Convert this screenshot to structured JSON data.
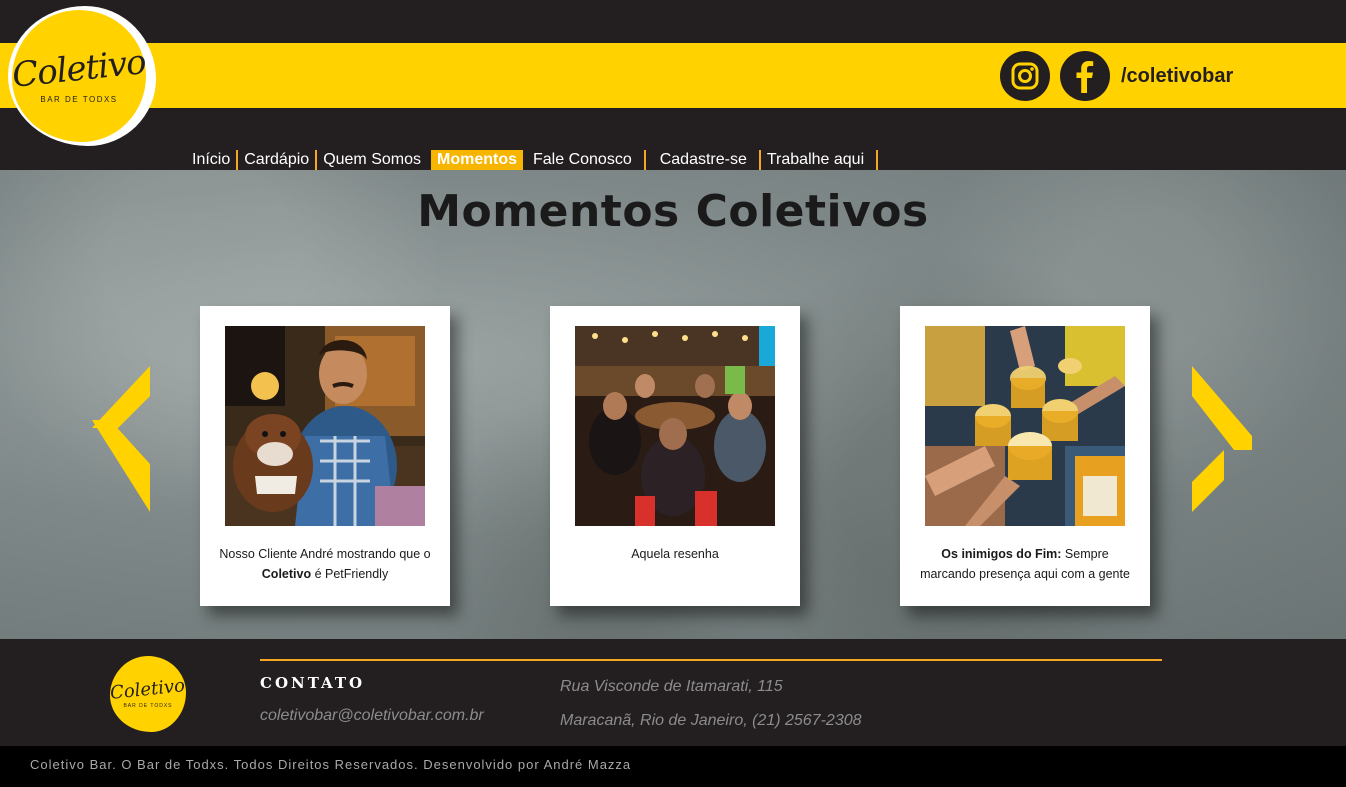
{
  "brand": {
    "logo_text": "Coletivo",
    "logo_sub": "BAR DE TODXS",
    "primary_color": "#ffd200",
    "dark_color": "#231f20",
    "accent_color": "#f5a623"
  },
  "social": {
    "icons": [
      "instagram-icon",
      "facebook-icon"
    ],
    "handle": "/coletivobar"
  },
  "nav": {
    "items": [
      {
        "label": "Início"
      },
      {
        "label": "Cardápio"
      },
      {
        "label": "Quem Somos"
      },
      {
        "label": "Momentos",
        "active": true
      },
      {
        "label": "Fale Conosco"
      },
      {
        "label": "Cadastre-se"
      },
      {
        "label": "Trabalhe aqui"
      }
    ]
  },
  "main": {
    "title": "Momentos Coletivos",
    "cards": [
      {
        "caption_pre": "Nosso Cliente André mostrando que o ",
        "caption_bold": "Coletivo",
        "caption_post": " é PetFriendly"
      },
      {
        "caption_pre": "Aquela resenha",
        "caption_bold": "",
        "caption_post": ""
      },
      {
        "caption_pre": "",
        "caption_bold": "Os inimigos do Fim:",
        "caption_post": " Sempre marcando presença aqui com a gente"
      }
    ],
    "prev_icon": "chevron-left-icon",
    "next_icon": "chevron-right-icon"
  },
  "footer": {
    "logo_text": "Coletivo",
    "logo_sub": "BAR DE TODXS",
    "heading": "CONTATO",
    "email": "coletivobar@coletivobar.com.br",
    "address_line1": "Rua Visconde de Itamarati, 115",
    "address_line2": "Maracanã, Rio de Janeiro, (21) 2567-2308",
    "copyright": "Coletivo Bar. O Bar de Todxs. Todos Direitos Reservados. Desenvolvido por André Mazza"
  }
}
